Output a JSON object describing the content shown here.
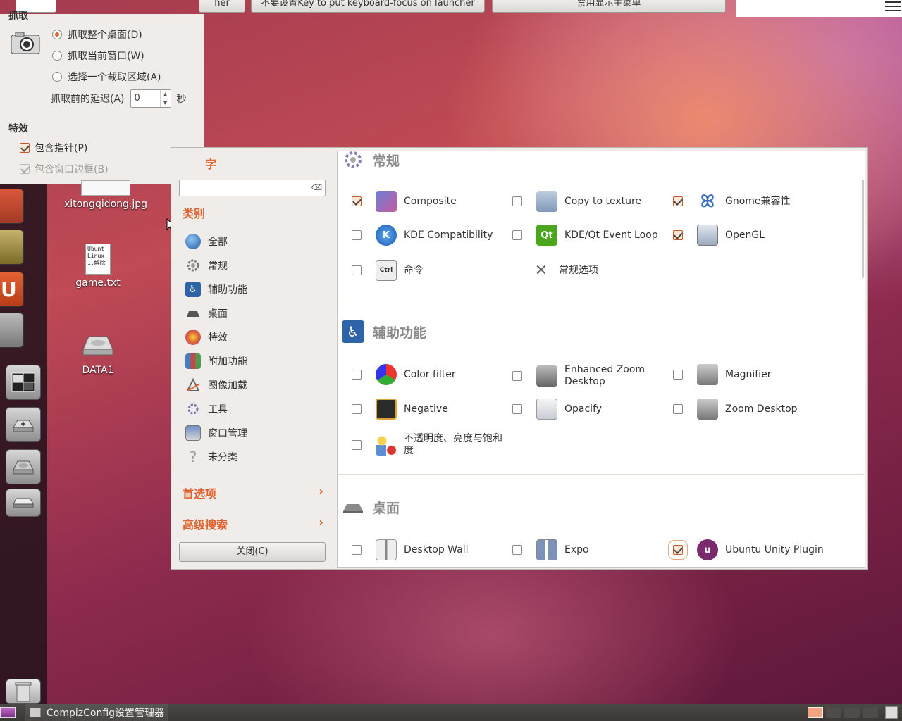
{
  "top_bar": {
    "btn1_label": "her",
    "btn2_label": "不要设置Key to put keyboard-focus on launcher",
    "btn3_label": "禁用显示主菜单"
  },
  "screenshot_dialog": {
    "header_partial": "抓取",
    "options": [
      {
        "label": "抓取整个桌面(D)",
        "selected": true
      },
      {
        "label": "抓取当前窗口(W)",
        "selected": false
      },
      {
        "label": "选择一个截取区域(A)",
        "selected": false
      }
    ],
    "delay_label": "抓取前的延迟(A)",
    "delay_value": "0",
    "delay_unit": "秒",
    "effects_title": "特效",
    "include_pointer": {
      "label": "包含指针(P)",
      "checked": true
    },
    "include_border": {
      "label": "包含窗口边框(B)",
      "checked": true,
      "disabled": true
    }
  },
  "desktop_icons": [
    {
      "label": "xitongqidong.jpg"
    },
    {
      "label": "game.txt",
      "preview_lines": [
        "Ubunt",
        "Linux",
        "1.解除"
      ]
    },
    {
      "label": "DATA1"
    }
  ],
  "ccsm": {
    "filter_title_partial": "字",
    "search_placeholder": "",
    "category_title": "类别",
    "categories": [
      {
        "label": "全部",
        "icon": "globe-icon"
      },
      {
        "label": "常规",
        "icon": "gear-icon"
      },
      {
        "label": "辅助功能",
        "icon": "accessibility-icon"
      },
      {
        "label": "桌面",
        "icon": "desktop-icon"
      },
      {
        "label": "特效",
        "icon": "effects-icon"
      },
      {
        "label": "附加功能",
        "icon": "books-icon"
      },
      {
        "label": "图像加载",
        "icon": "image-loading-icon"
      },
      {
        "label": "工具",
        "icon": "tools-icon"
      },
      {
        "label": "窗口管理",
        "icon": "window-management-icon"
      },
      {
        "label": "未分类",
        "icon": "question-icon"
      }
    ],
    "preferences_label": "首选项",
    "advanced_search_label": "高级搜索",
    "close_label": "关闭(C)",
    "sections": [
      {
        "title": "常规",
        "plugins": [
          {
            "label": "Composite",
            "checked": true,
            "icon": "composite-icon"
          },
          {
            "label": "Copy to texture",
            "checked": false,
            "icon": "copy-texture-icon"
          },
          {
            "label": "Gnome兼容性",
            "checked": true,
            "icon": "gnome-icon"
          },
          {
            "label": "KDE Compatibility",
            "checked": false,
            "icon": "kde-icon"
          },
          {
            "label": "KDE/Qt Event Loop",
            "checked": false,
            "icon": "qt-icon"
          },
          {
            "label": "OpenGL",
            "checked": true,
            "icon": "opengl-icon"
          },
          {
            "label": "命令",
            "checked": false,
            "icon": "command-keys-icon"
          },
          {
            "label": "常规选项",
            "checked": null,
            "icon": "tools-icon"
          }
        ]
      },
      {
        "title": "辅助功能",
        "plugins": [
          {
            "label": "Color filter",
            "checked": false,
            "icon": "color-filter-icon"
          },
          {
            "label": "Enhanced Zoom Desktop",
            "checked": false,
            "icon": "enhanced-zoom-icon"
          },
          {
            "label": "Magnifier",
            "checked": false,
            "icon": "magnifier-icon"
          },
          {
            "label": "Negative",
            "checked": false,
            "icon": "negative-icon"
          },
          {
            "label": "Opacify",
            "checked": false,
            "icon": "opacify-icon"
          },
          {
            "label": "Zoom Desktop",
            "checked": false,
            "icon": "zoom-desktop-icon"
          },
          {
            "label": "不透明度、亮度与饱和度",
            "checked": false,
            "icon": "obs-icon"
          }
        ]
      },
      {
        "title": "桌面",
        "plugins": [
          {
            "label": "Desktop Wall",
            "checked": false,
            "icon": "desktop-wall-icon"
          },
          {
            "label": "Expo",
            "checked": false,
            "icon": "expo-icon"
          },
          {
            "label": "Ubuntu Unity Plugin",
            "checked": true,
            "icon": "unity-icon"
          }
        ]
      }
    ]
  },
  "taskbar": {
    "task_label": "CompizConfig设置管理器"
  },
  "colors": {
    "accent": "#e0632f",
    "panel": "#3c3b37",
    "window_bg": "#efece9"
  }
}
